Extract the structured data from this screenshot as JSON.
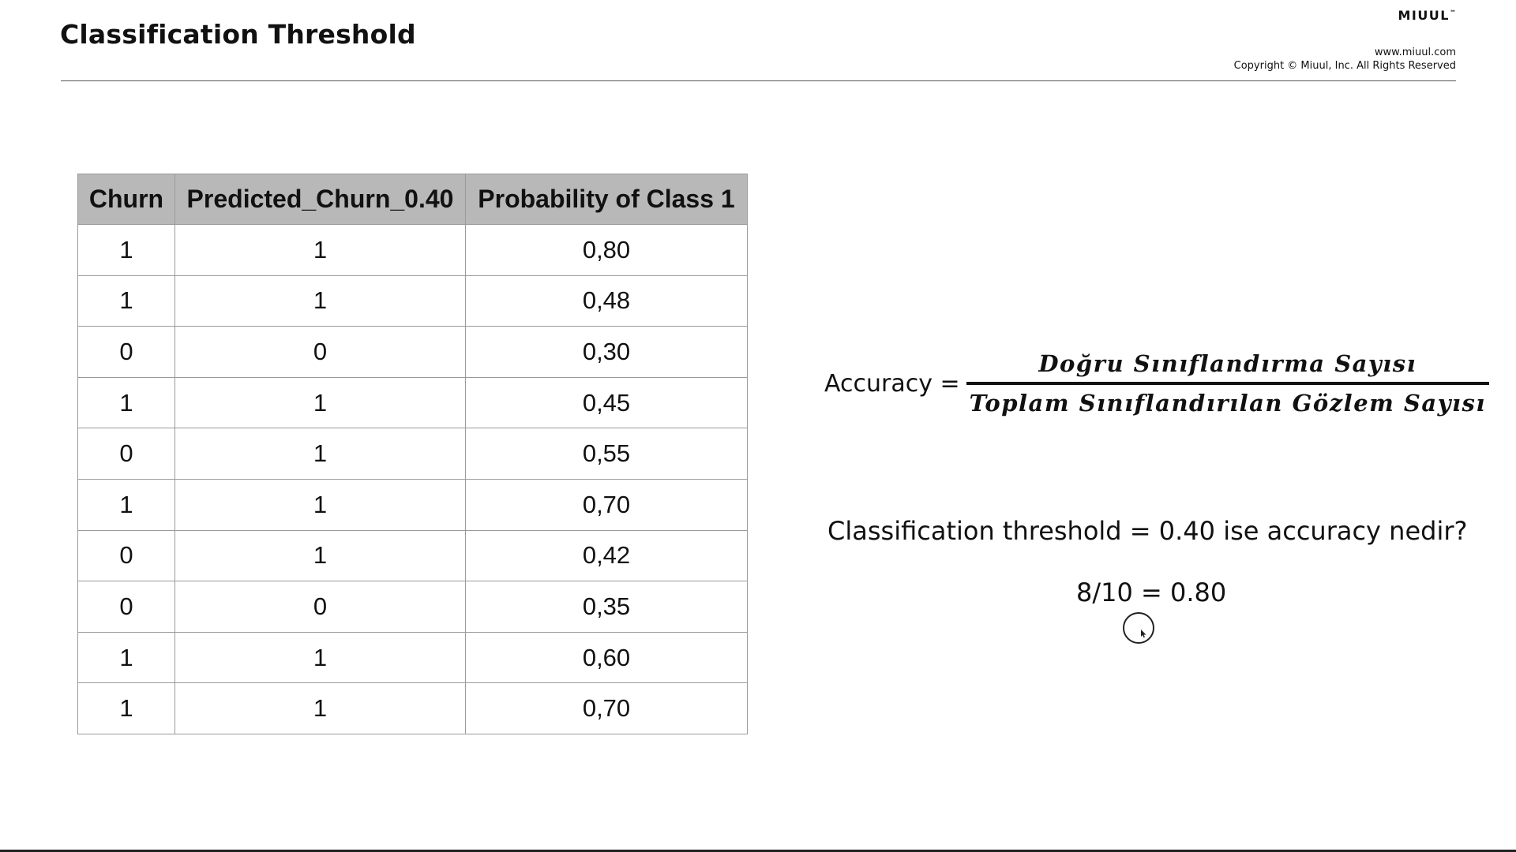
{
  "header": {
    "title": "Classification Threshold",
    "brand": "MIUUL",
    "brand_mark": "™",
    "website": "www.miuul.com",
    "copyright": "Copyright © Miuul, Inc. All Rights Reserved"
  },
  "table": {
    "headers": [
      "Churn",
      "Predicted_Churn_0.40",
      "Probability of Class 1"
    ],
    "rows": [
      [
        "1",
        "1",
        "0,80"
      ],
      [
        "1",
        "1",
        "0,48"
      ],
      [
        "0",
        "0",
        "0,30"
      ],
      [
        "1",
        "1",
        "0,45"
      ],
      [
        "0",
        "1",
        "0,55"
      ],
      [
        "1",
        "1",
        "0,70"
      ],
      [
        "0",
        "1",
        "0,42"
      ],
      [
        "0",
        "0",
        "0,35"
      ],
      [
        "1",
        "1",
        "0,60"
      ],
      [
        "1",
        "1",
        "0,70"
      ]
    ]
  },
  "formula": {
    "label": "Accuracy =",
    "numerator": "Doğru Sınıflandırma Sayısı",
    "denominator": "Toplam Sınıflandırılan Gözlem Sayısı"
  },
  "question": "Classification threshold = 0.40 ise accuracy nedir?",
  "answer": "8/10 = 0.80"
}
